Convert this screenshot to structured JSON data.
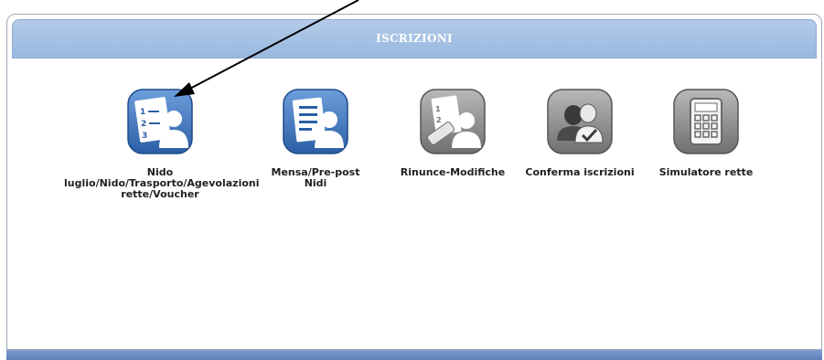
{
  "panel": {
    "title": "ISCRIZIONI"
  },
  "tiles": [
    {
      "label": "Nido\nluglio/Nido/Trasporto/Agevolazioni\nrette/Voucher",
      "icon": "form-person-icon",
      "style": "blue"
    },
    {
      "label": "Mensa/Pre-post Nidi",
      "icon": "document-person-icon",
      "style": "blue"
    },
    {
      "label": "Rinunce-Modifiche",
      "icon": "eraser-form-person-icon",
      "style": "gray"
    },
    {
      "label": "Conferma iscrizioni",
      "icon": "people-check-icon",
      "style": "gray"
    },
    {
      "label": "Simulatore rette",
      "icon": "calculator-icon",
      "style": "gray"
    }
  ],
  "colors": {
    "header": "#a7c2e4",
    "blue_icon": "#3f74b8",
    "gray_icon": "#8a8a8a",
    "footer": "#6f8fc6"
  }
}
